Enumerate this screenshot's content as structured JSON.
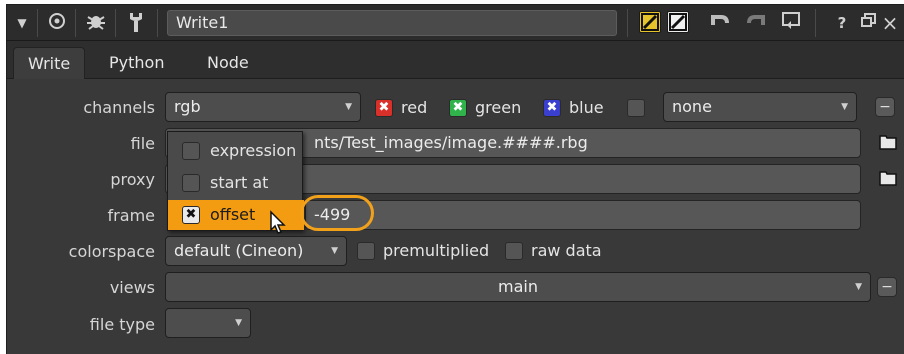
{
  "titlebar": {
    "node_name": "Write1",
    "icons": [
      "collapse-triangle-icon",
      "center-icon",
      "bug-icon",
      "wrench-icon",
      "yellow-slash-icon",
      "white-slash-icon",
      "undo-icon",
      "redo-icon",
      "revert-icon",
      "help-icon",
      "float-icon",
      "close-icon"
    ],
    "help_label": "?",
    "close_label": "×"
  },
  "tabs": [
    "Write",
    "Python",
    "Node"
  ],
  "rows": {
    "channels": {
      "label": "channels",
      "value": "rgb",
      "red": "red",
      "green": "green",
      "blue": "blue",
      "alpha_value": "none"
    },
    "file": {
      "label": "file",
      "value": "nts/Test_images/image.####.rbg"
    },
    "proxy": {
      "label": "proxy",
      "value": ""
    },
    "frame": {
      "label": "frame",
      "value": "-499"
    },
    "colorspace": {
      "label": "colorspace",
      "value": "default (Cineon)",
      "premultiplied": "premultiplied",
      "raw_data": "raw data"
    },
    "views": {
      "label": "views",
      "value": "main"
    },
    "file_type": {
      "label": "file type",
      "value": ""
    }
  },
  "popup_menu": {
    "items": [
      {
        "label": "expression",
        "checked": false
      },
      {
        "label": "start at",
        "checked": false
      },
      {
        "label": "offset",
        "checked": true
      }
    ]
  },
  "colors": {
    "red_check": "#d9302a",
    "green_check": "#2fb34a",
    "blue_check": "#3a3fd0",
    "menu_highlight": "#f39c12",
    "annotation_ring": "#f2a11b"
  },
  "check_glyph": "✖",
  "plus_glyph": "−"
}
